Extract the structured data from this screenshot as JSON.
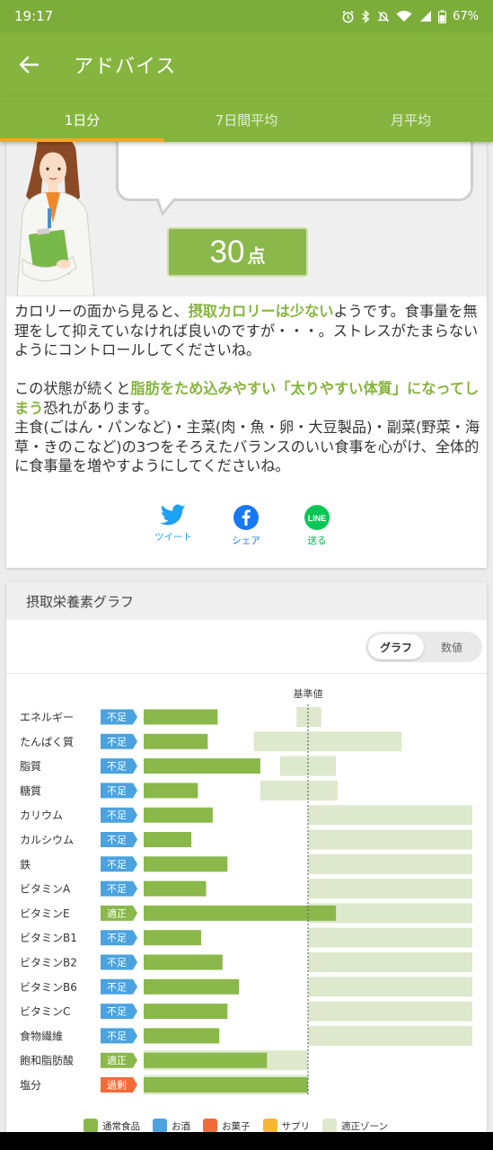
{
  "status_bar": {
    "time": "19:17",
    "battery": "67%"
  },
  "app_bar": {
    "title": "アドバイス"
  },
  "tabs": [
    {
      "label": "1日分",
      "active": true
    },
    {
      "label": "7日間平均",
      "active": false
    },
    {
      "label": "月平均",
      "active": false
    }
  ],
  "score": {
    "value": "30",
    "unit": "点"
  },
  "advice": {
    "p1_prefix": "カロリーの面から見ると、",
    "p1_highlight": "摂取カロリーは少ない",
    "p1_suffix": "ようです。食事量を無理をして抑えていなければ良いのですが・・・。ストレスがたまらないようにコントロールしてくださいね。",
    "p2_prefix": "この状態が続くと",
    "p2_highlight": "脂肪をため込みやすい「太りやすい体質」になってしまう",
    "p2_suffix": "恐れがあります。",
    "p3": "主食(ごはん・パンなど)・主菜(肉・魚・卵・大豆製品)・副菜(野菜・海草・きのこなど)の3つをそろえたバランスのいい食事を心がけ、全体的に食事量を増やすようにしてくださいね。"
  },
  "share": {
    "twitter": "ツイート",
    "facebook": "シェア",
    "line_icon": "LINE",
    "line": "送る"
  },
  "colors": {
    "green": "#8ab84a",
    "zone": "#dde8cc",
    "blue": "#4aa3df",
    "red": "#f26b38",
    "yellow": "#f7b733"
  },
  "graph_section": {
    "title": "摂取栄養素グラフ",
    "toggle": [
      "グラフ",
      "数値"
    ],
    "active_toggle": "グラフ"
  },
  "chart_data": {
    "type": "bar",
    "reference_label": "基準値",
    "reference_value": 100,
    "xlim": [
      0,
      200
    ],
    "rows": [
      {
        "name": "エネルギー",
        "status": "不足",
        "status_color": "#4aa3df",
        "value": 45,
        "zone": [
          93,
          108
        ]
      },
      {
        "name": "たんぱく質",
        "status": "不足",
        "status_color": "#4aa3df",
        "value": 39,
        "zone": [
          67,
          157
        ]
      },
      {
        "name": "脂質",
        "status": "不足",
        "status_color": "#4aa3df",
        "value": 71,
        "zone": [
          83,
          117
        ]
      },
      {
        "name": "糖質",
        "status": "不足",
        "status_color": "#4aa3df",
        "value": 33,
        "zone": [
          71,
          118
        ]
      },
      {
        "name": "カリウム",
        "status": "不足",
        "status_color": "#4aa3df",
        "value": 42,
        "zone": [
          100,
          200
        ]
      },
      {
        "name": "カルシウム",
        "status": "不足",
        "status_color": "#4aa3df",
        "value": 29,
        "zone": [
          100,
          200
        ]
      },
      {
        "name": "鉄",
        "status": "不足",
        "status_color": "#4aa3df",
        "value": 51,
        "zone": [
          100,
          200
        ]
      },
      {
        "name": "ビタミンA",
        "status": "不足",
        "status_color": "#4aa3df",
        "value": 38,
        "zone": [
          100,
          200
        ]
      },
      {
        "name": "ビタミンE",
        "status": "適正",
        "status_color": "#8ab84a",
        "value": 117,
        "zone": [
          100,
          200
        ]
      },
      {
        "name": "ビタミンB1",
        "status": "不足",
        "status_color": "#4aa3df",
        "value": 35,
        "zone": [
          100,
          200
        ]
      },
      {
        "name": "ビタミンB2",
        "status": "不足",
        "status_color": "#4aa3df",
        "value": 48,
        "zone": [
          100,
          200
        ]
      },
      {
        "name": "ビタミンB6",
        "status": "不足",
        "status_color": "#4aa3df",
        "value": 58,
        "zone": [
          100,
          200
        ]
      },
      {
        "name": "ビタミンC",
        "status": "不足",
        "status_color": "#4aa3df",
        "value": 51,
        "zone": [
          100,
          200
        ]
      },
      {
        "name": "食物繊維",
        "status": "不足",
        "status_color": "#4aa3df",
        "value": 46,
        "zone": [
          100,
          200
        ]
      },
      {
        "name": "飽和脂肪酸",
        "status": "適正",
        "status_color": "#8ab84a",
        "value": 75,
        "zone": [
          0,
          100
        ]
      },
      {
        "name": "塩分",
        "status": "過剰",
        "status_color": "#f26b38",
        "value": 100,
        "zone": [
          0,
          100
        ]
      }
    ],
    "legend": [
      {
        "name": "通常食品",
        "color": "#8ab84a"
      },
      {
        "name": "お酒",
        "color": "#4aa3df"
      },
      {
        "name": "お菓子",
        "color": "#f26b38"
      },
      {
        "name": "サプリ",
        "color": "#f7b733"
      },
      {
        "name": "適正ゾーン",
        "color": "#dde8cc"
      }
    ]
  }
}
